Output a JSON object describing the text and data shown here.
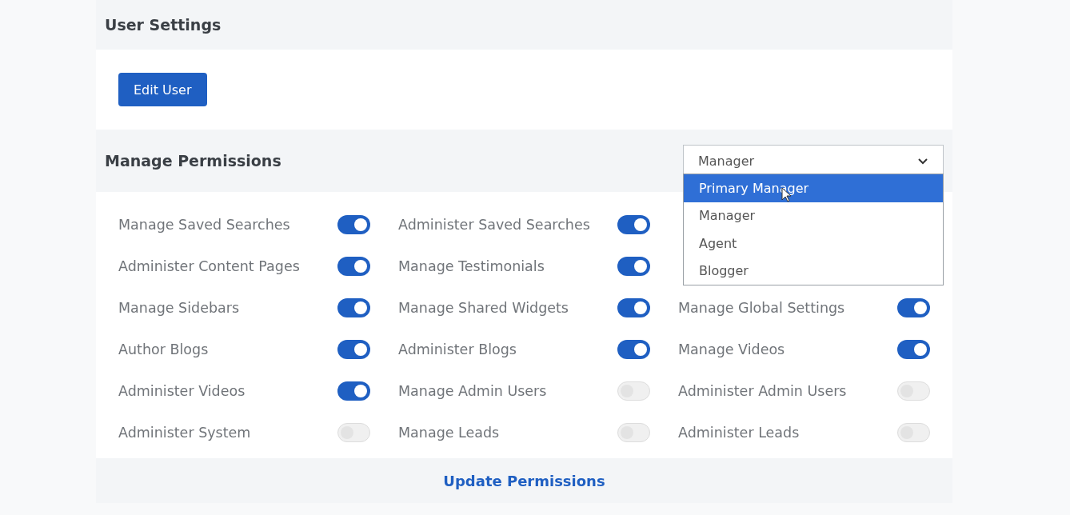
{
  "user_settings": {
    "title": "User Settings",
    "edit_button": "Edit User"
  },
  "permissions": {
    "title": "Manage Permissions",
    "role_select": {
      "value": "Manager",
      "expanded": true,
      "options": [
        {
          "label": "Primary Manager",
          "highlighted": true
        },
        {
          "label": "Manager",
          "highlighted": false
        },
        {
          "label": "Agent",
          "highlighted": false
        },
        {
          "label": "Blogger",
          "highlighted": false
        }
      ]
    },
    "rows": [
      [
        {
          "label": "Manage Saved Searches",
          "on": true
        },
        {
          "label": "Administer Saved Searches",
          "on": true
        }
      ],
      [
        {
          "label": "Administer Content Pages",
          "on": true
        },
        {
          "label": "Manage Testimonials",
          "on": true
        }
      ],
      [
        {
          "label": "Manage Sidebars",
          "on": true
        },
        {
          "label": "Manage Shared Widgets",
          "on": true
        },
        {
          "label": "Manage Global Settings",
          "on": true
        }
      ],
      [
        {
          "label": "Author Blogs",
          "on": true
        },
        {
          "label": "Administer Blogs",
          "on": true
        },
        {
          "label": "Manage Videos",
          "on": true
        }
      ],
      [
        {
          "label": "Administer Videos",
          "on": true
        },
        {
          "label": "Manage Admin Users",
          "on": false
        },
        {
          "label": "Administer Admin Users",
          "on": false
        }
      ],
      [
        {
          "label": "Administer System",
          "on": false
        },
        {
          "label": "Manage Leads",
          "on": false
        },
        {
          "label": "Administer Leads",
          "on": false
        }
      ]
    ],
    "update_link": "Update Permissions"
  }
}
